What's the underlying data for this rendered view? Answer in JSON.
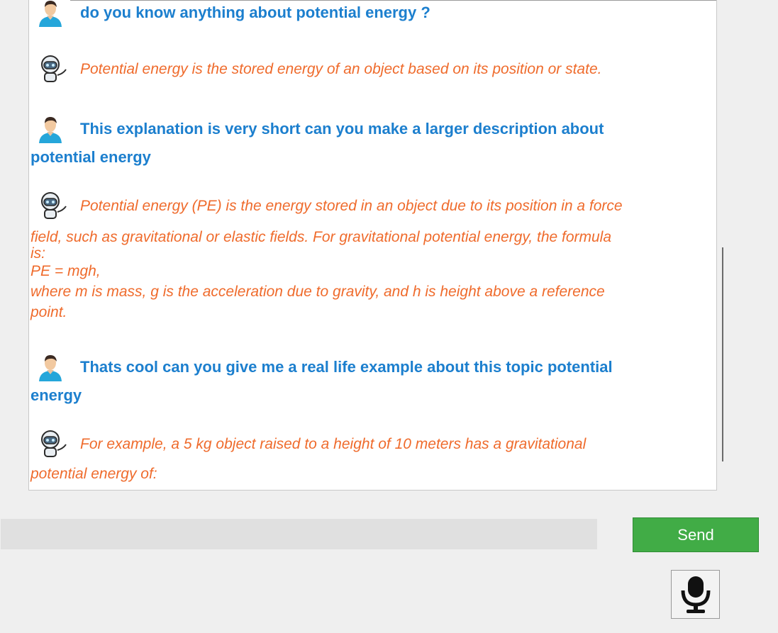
{
  "chat": {
    "messages": [
      {
        "role": "user",
        "avatar": "user-avatar-icon",
        "first_line": "do you know anything about potential energy ?",
        "lines": []
      },
      {
        "role": "bot",
        "avatar": "robot-avatar-icon",
        "first_line": "Potential energy is the stored energy of an object based on its position or state.",
        "lines": []
      },
      {
        "role": "user",
        "avatar": "user-avatar-icon",
        "first_line": "This explanation is very short can you make a larger description about",
        "lines": [
          "potential energy"
        ]
      },
      {
        "role": "bot",
        "avatar": "robot-avatar-icon",
        "first_line": "Potential energy (PE) is the energy stored in an object due to its position in a force",
        "lines": [
          "field, such as gravitational or elastic fields. For gravitational potential energy, the formula",
          "is:",
          "PE = mgh,",
          "where m is mass, g is the acceleration due to gravity, and h is height above a reference",
          "point."
        ]
      },
      {
        "role": "user",
        "avatar": "user-avatar-icon",
        "first_line": "Thats cool can you give me a real life example about this topic potential",
        "lines": [
          "energy"
        ]
      },
      {
        "role": "bot",
        "avatar": "robot-avatar-icon",
        "first_line": "For example, a 5 kg object raised to a height of 10 meters has a gravitational",
        "lines": [
          "potential energy of:"
        ]
      }
    ]
  },
  "input": {
    "value": "",
    "placeholder": ""
  },
  "send_button": {
    "label": "Send"
  },
  "mic_button": {
    "icon": "microphone-icon"
  },
  "colors": {
    "user_text": "#1c7fce",
    "bot_text": "#ef6b2c",
    "send_bg": "#41ac46",
    "input_bg": "#e0e0e0"
  }
}
